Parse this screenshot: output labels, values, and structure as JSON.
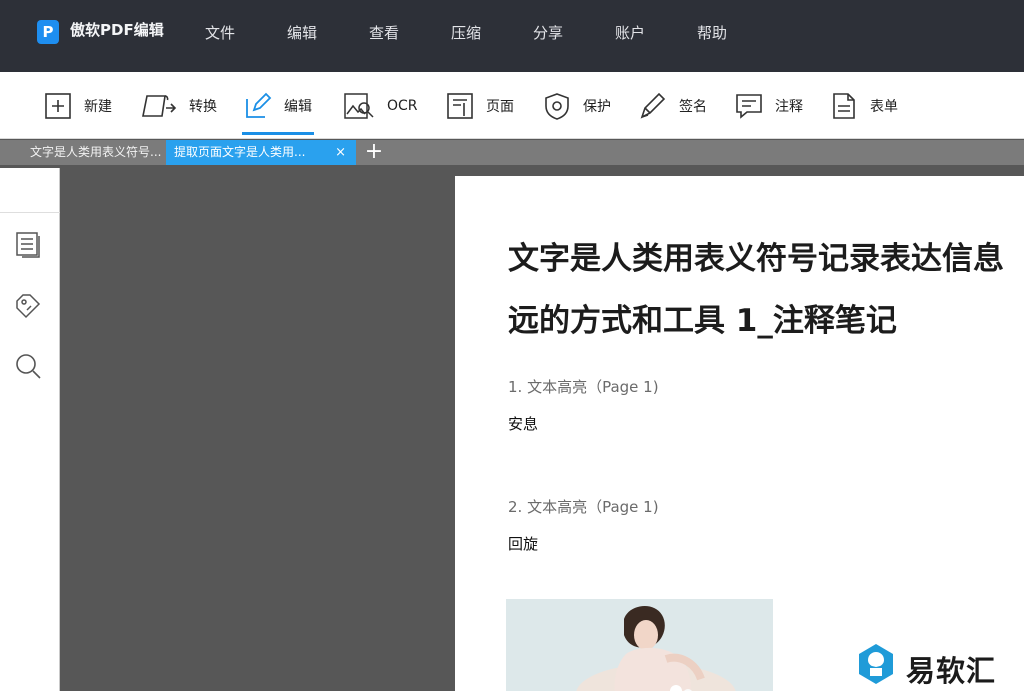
{
  "app": {
    "logo_letter": "P",
    "title": "傲软PDF编辑"
  },
  "menu": [
    "文件",
    "编辑",
    "查看",
    "压缩",
    "分享",
    "账户",
    "帮助"
  ],
  "toolbar": {
    "active": "编辑",
    "accent_color": "#1b8fe6",
    "tools": [
      {
        "label": "新建",
        "icon": "plus-box-icon"
      },
      {
        "label": "转换",
        "icon": "convert-icon"
      },
      {
        "label": "编辑",
        "icon": "pencil-edit-icon"
      },
      {
        "label": "OCR",
        "icon": "ocr-scan-icon"
      },
      {
        "label": "页面",
        "icon": "page-icon"
      },
      {
        "label": "保护",
        "icon": "shield-icon"
      },
      {
        "label": "签名",
        "icon": "pen-icon"
      },
      {
        "label": "注释",
        "icon": "comment-icon"
      },
      {
        "label": "表单",
        "icon": "form-icon"
      }
    ]
  },
  "tabs": [
    {
      "title": "文字是人类用表义符号...",
      "active": false
    },
    {
      "title": "提取页面文字是人类用...",
      "active": true,
      "close": "×"
    }
  ],
  "add_tab": "+",
  "sidebar": {
    "icons": [
      "thumbnails-icon",
      "tag-icon",
      "search-icon"
    ]
  },
  "document": {
    "title_lines": [
      "文字是人类用表义符号记录表达信息",
      "远的方式和工具 1_注释笔记"
    ],
    "notes": [
      {
        "heading": "1. 文本高亮（Page 1)",
        "text": "安息"
      },
      {
        "heading": "2. 文本高亮（Page 1)",
        "text": "回旋"
      }
    ]
  },
  "watermark": {
    "text": "易软汇",
    "color": "#1f9bd8"
  }
}
